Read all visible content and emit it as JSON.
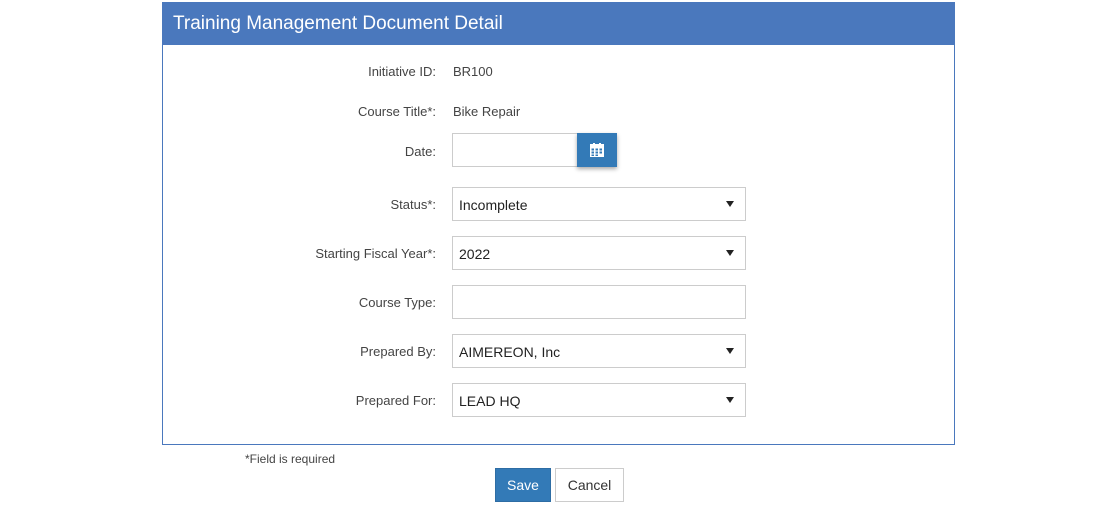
{
  "panel": {
    "title": "Training Management Document Detail"
  },
  "form": {
    "initiative_id": {
      "label": "Initiative ID:",
      "value": "BR100"
    },
    "course_title": {
      "label": "Course Title*:",
      "value": "Bike Repair"
    },
    "date": {
      "label": "Date:",
      "value": "",
      "icon": "calendar-icon"
    },
    "status": {
      "label": "Status*:",
      "value": "Incomplete"
    },
    "starting_fiscal_year": {
      "label": "Starting Fiscal Year*:",
      "value": "2022"
    },
    "course_type": {
      "label": "Course Type:",
      "value": ""
    },
    "prepared_by": {
      "label": "Prepared By:",
      "value": "AIMEREON, Inc"
    },
    "prepared_for": {
      "label": "Prepared For:",
      "value": "LEAD HQ"
    }
  },
  "footnote": "*Field is required",
  "actions": {
    "save_label": "Save",
    "cancel_label": "Cancel"
  },
  "colors": {
    "header_bg": "#4a78bd",
    "primary_button": "#337ab7"
  }
}
